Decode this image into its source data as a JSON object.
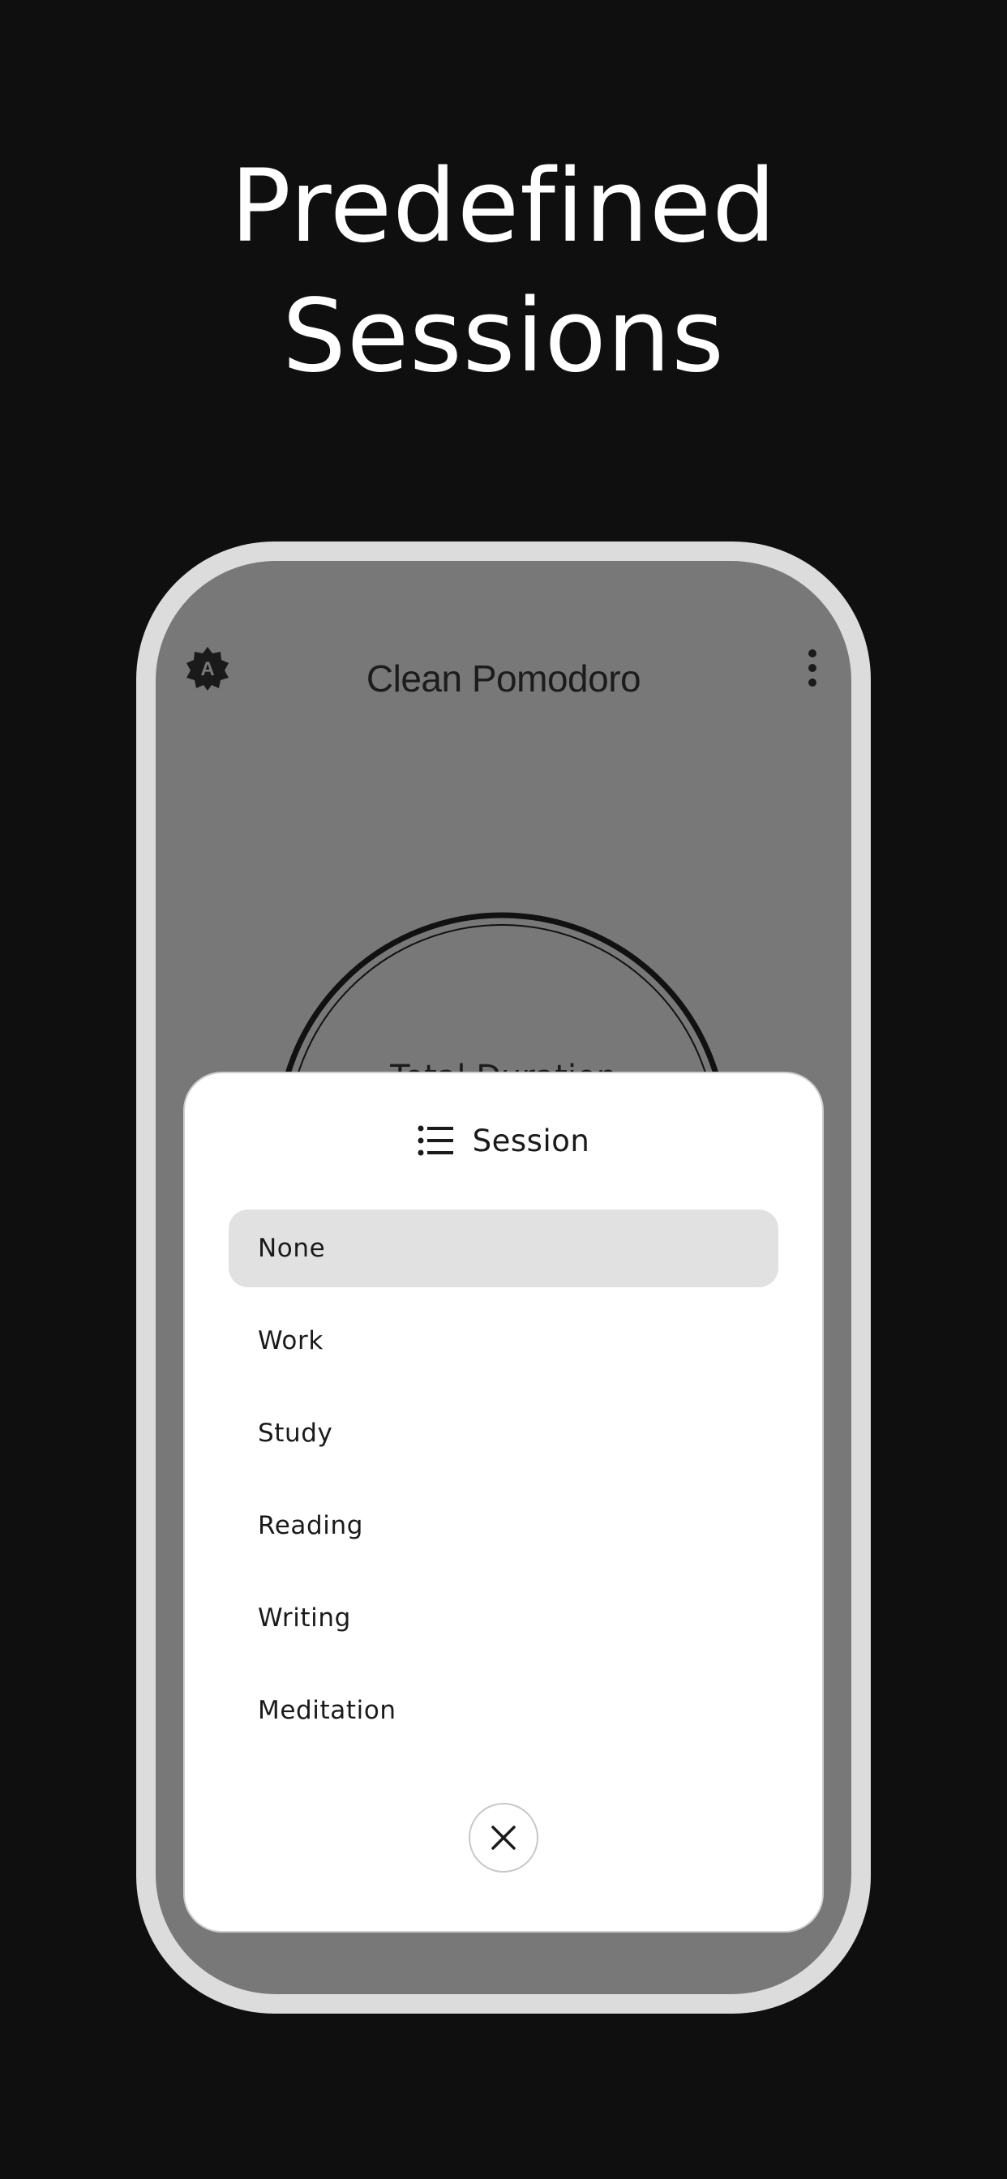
{
  "headline": {
    "line1": "Predefined",
    "line2": "Sessions"
  },
  "app": {
    "title": "Clean Pomodoro",
    "timer_label": "Total Duration"
  },
  "icons": {
    "theme": "auto-theme-icon",
    "more": "more-vert-icon",
    "session": "list-icon",
    "close": "close-icon"
  },
  "sheet": {
    "title": "Session",
    "options": [
      {
        "label": "None",
        "selected": true
      },
      {
        "label": "Work",
        "selected": false
      },
      {
        "label": "Study",
        "selected": false
      },
      {
        "label": "Reading",
        "selected": false
      },
      {
        "label": "Writing",
        "selected": false
      },
      {
        "label": "Meditation",
        "selected": false
      }
    ]
  },
  "colors": {
    "background": "#0f0f0f",
    "phone_frame": "#dcdcdc",
    "screen_scrim": "#787878",
    "sheet": "#ffffff",
    "selected_option": "#e1e1e1"
  }
}
